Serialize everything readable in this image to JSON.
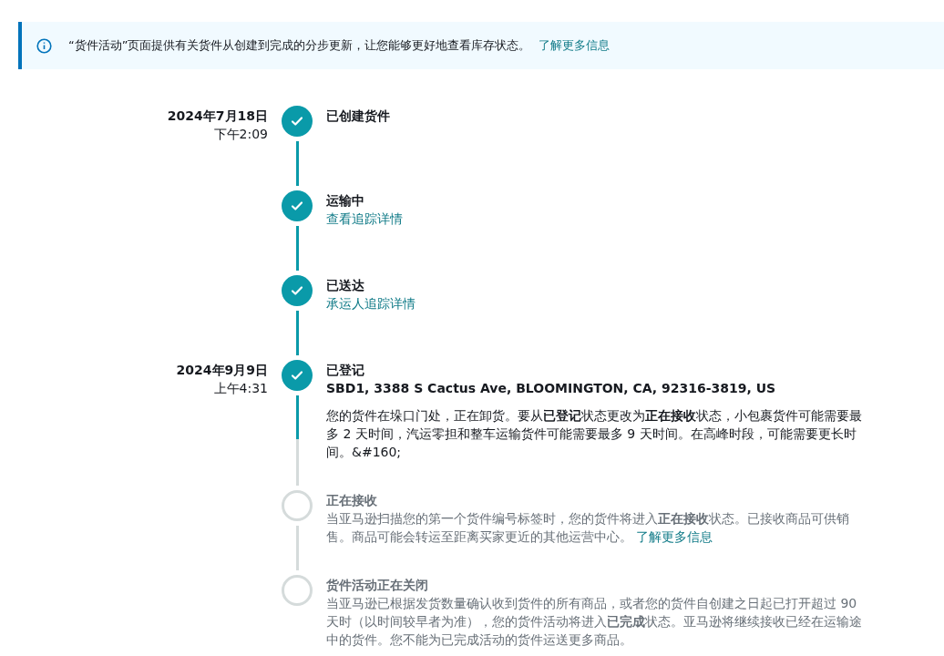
{
  "banner": {
    "text": "“货件活动”页面提供有关货件从创建到完成的分步更新，让您能够更好地查看库存状态。",
    "link": "了解更多信息"
  },
  "steps": [
    {
      "date": "2024年7月18日",
      "time": "下午2:09",
      "title": "已创建货件",
      "completed": true
    },
    {
      "title": "运输中",
      "link": "查看追踪详情",
      "completed": true
    },
    {
      "title": "已送达",
      "link": "承运人追踪详情",
      "completed": true
    },
    {
      "date": "2024年9月9日",
      "time": "上午4:31",
      "title": "已登记",
      "address": "SBD1, 3388 S Cactus Ave, BLOOMINGTON, CA, 92316-3819, US",
      "description": "您的货件在垛口门处，正在卸货。要从**已登记**状态更改为**正在接收**状态，小包裹货件可能需要最多 2 天时间，汽运零担和整车运输货件可能需要最多 9 天时间。在高峰时段，可能需要更长时间。&#160;",
      "completed": true
    },
    {
      "title": "正在接收",
      "description": "当亚马逊扫描您的第一个货件编号标签时，您的货件将进入**正在接收**状态。已接收商品可供销售。商品可能会转运至距离买家更近的其他运营中心。",
      "description_link": "了解更多信息",
      "completed": false
    },
    {
      "title": "货件活动正在关闭",
      "description": "当亚马逊已根据发货数量确认收到货件的所有商品，或者您的货件自创建之日起已打开超过 90 天时（以时间较早者为准），您的货件活动将进入**已完成**状态。亚马逊将继续接收已经在运输途中的货件。您不能为已完成活动的货件运送更多商品。",
      "completed": false
    }
  ]
}
